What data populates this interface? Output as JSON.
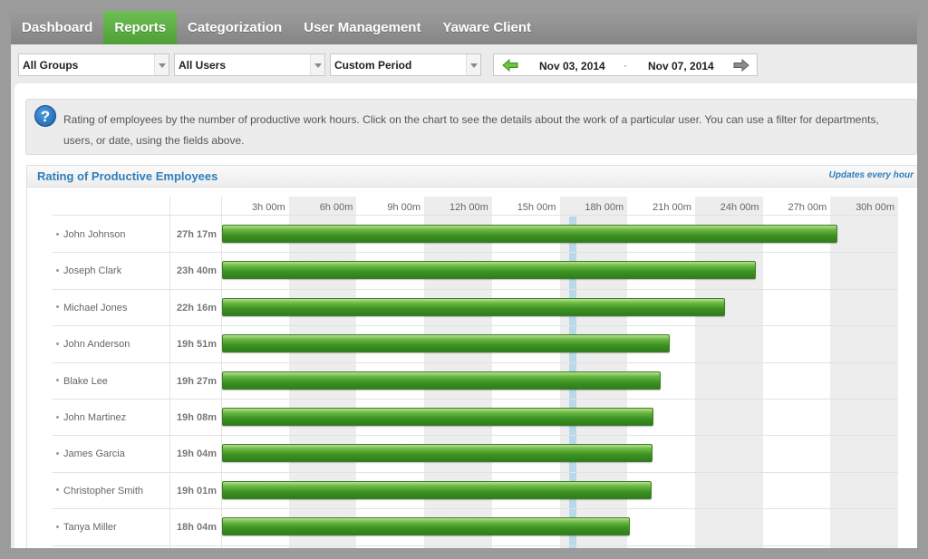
{
  "nav": {
    "items": [
      {
        "label": "Dashboard",
        "active": false
      },
      {
        "label": "Reports",
        "active": true
      },
      {
        "label": "Categorization",
        "active": false
      },
      {
        "label": "User Management",
        "active": false
      },
      {
        "label": "Yaware Client",
        "active": false
      }
    ]
  },
  "filters": {
    "group": "All Groups",
    "user": "All Users",
    "period": "Custom Period",
    "date_from": "Nov 03, 2014",
    "date_separator": "-",
    "date_to": "Nov 07, 2014"
  },
  "info": {
    "icon": "help-icon",
    "text": "Rating of employees by the number of productive work hours. Click on the chart to see the details about the work of a particular user. You can use a filter for departments, users, or date, using the fields above."
  },
  "chart": {
    "title": "Rating of Productive Employees",
    "note": "Updates every hour",
    "bar_color": "#3d9224"
  },
  "chart_data": {
    "type": "bar",
    "orientation": "horizontal",
    "x_ticks": [
      "3h 00m",
      "6h 00m",
      "9h 00m",
      "12h 00m",
      "15h 00m",
      "18h 00m",
      "21h 00m",
      "24h 00m",
      "27h 00m",
      "30h 00m"
    ],
    "xlim_hours": [
      0,
      30
    ],
    "categories": [
      "John Johnson",
      "Joseph Clark",
      "Michael Jones",
      "John Anderson",
      "Blake Lee",
      "John Martinez",
      "James Garcia",
      "Christopher Smith",
      "Tanya Miller"
    ],
    "labels": [
      "27h 17m",
      "23h 40m",
      "22h 16m",
      "19h 51m",
      "19h 27m",
      "19h 08m",
      "19h 04m",
      "19h 01m",
      "18h 04m"
    ],
    "values_hours": [
      27.28,
      23.67,
      22.27,
      19.85,
      19.45,
      19.13,
      19.07,
      19.02,
      18.07
    ],
    "marker_hours": 15.6
  }
}
